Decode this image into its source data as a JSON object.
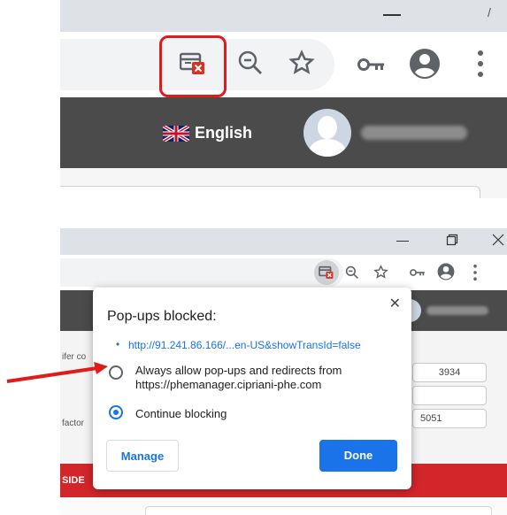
{
  "top_view": {
    "language_label": "English",
    "icons": [
      "popup-blocked-icon",
      "zoom-out-icon",
      "star-icon",
      "key-icon",
      "account-icon",
      "menu-icon"
    ],
    "highlight_color": "#e01b1b"
  },
  "bottom_view": {
    "window_controls": [
      "minimize-icon",
      "restore-icon",
      "close-icon"
    ],
    "popup": {
      "title": "Pop-ups blocked:",
      "blocked_link": "http://91.241.86.166/...en-US&showTransId=false",
      "option_allow_line1": "Always allow pop-ups and redirects from",
      "option_allow_line2": "https://phemanager.cipriani-phe.com",
      "option_block": "Continue blocking",
      "selected_option": "Continue blocking",
      "manage_label": "Manage",
      "done_label": "Done"
    },
    "background_form": {
      "left_fragment_1": "ifer co",
      "left_fragment_2": "factor",
      "value_1": "3934",
      "value_2": "5051",
      "section_label": "SIDE"
    },
    "accent_color": "#1a73e8",
    "section_color": "#d3262b"
  }
}
